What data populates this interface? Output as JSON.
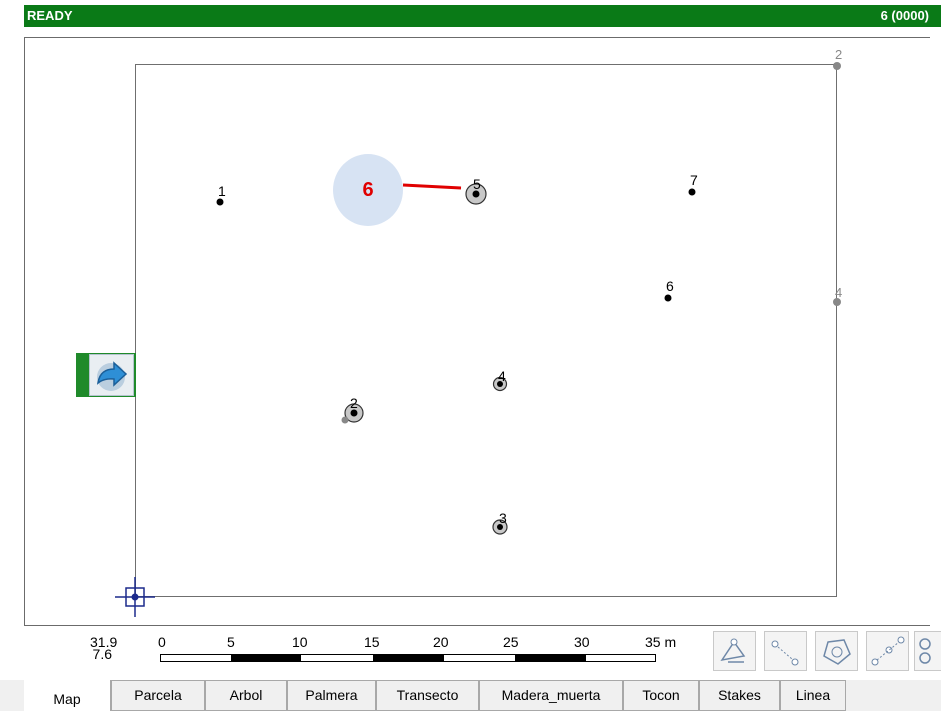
{
  "status": {
    "left": "READY",
    "right": "6 (0000)"
  },
  "map": {
    "annotation_label": "6",
    "stakes": [
      "2",
      "4"
    ],
    "points": [
      "1",
      "7",
      "6"
    ],
    "trees": [
      "5",
      "4",
      "2",
      "3"
    ]
  },
  "scale": {
    "coord_x": "31.9",
    "coord_y": "7.6",
    "ticks": [
      "0",
      "5",
      "10",
      "15",
      "20",
      "25",
      "30",
      "35 m"
    ]
  },
  "toolbar": [
    "edit-vertex-icon",
    "move-vertex-icon",
    "polygon-icon",
    "add-vertex-icon",
    "link-icon"
  ],
  "tabs": [
    "Map",
    "Parcela",
    "Arbol",
    "Palmera",
    "Transecto",
    "Madera_muerta",
    "Tocon",
    "Stakes",
    "Linea"
  ],
  "active_tab": "Map",
  "colors": {
    "status": "#0a7a17",
    "annotation": "#e00000",
    "annotation_bg": "#d7e3f3"
  }
}
